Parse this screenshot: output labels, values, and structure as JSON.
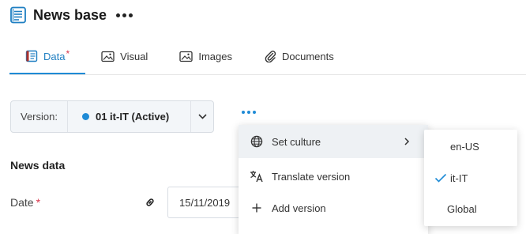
{
  "header": {
    "title": "News base",
    "icon": "news-document-icon"
  },
  "tabs": [
    {
      "label": "Data",
      "required": "*",
      "icon": "data-book-icon",
      "active": true
    },
    {
      "label": "Visual",
      "icon": "image-icon"
    },
    {
      "label": "Images",
      "icon": "image-icon"
    },
    {
      "label": "Documents",
      "icon": "paperclip-icon"
    }
  ],
  "version": {
    "label": "Version:",
    "value": "01 it-IT (Active)",
    "status_color": "#1f8bd6"
  },
  "section": {
    "title": "News data"
  },
  "date_field": {
    "label": "Date",
    "required": "*",
    "value": "15/11/2019"
  },
  "menu": {
    "items": [
      {
        "label": "Set culture",
        "icon": "globe-icon",
        "has_submenu": true
      },
      {
        "label": "Translate version",
        "icon": "translate-icon"
      },
      {
        "label": "Add version",
        "icon": "plus-icon"
      }
    ]
  },
  "submenu": {
    "items": [
      {
        "label": "en-US",
        "checked": false
      },
      {
        "label": "it-IT",
        "checked": true
      },
      {
        "label": "Global",
        "checked": false
      }
    ]
  },
  "colors": {
    "accent": "#1f8bd6",
    "required": "#d9364c"
  }
}
